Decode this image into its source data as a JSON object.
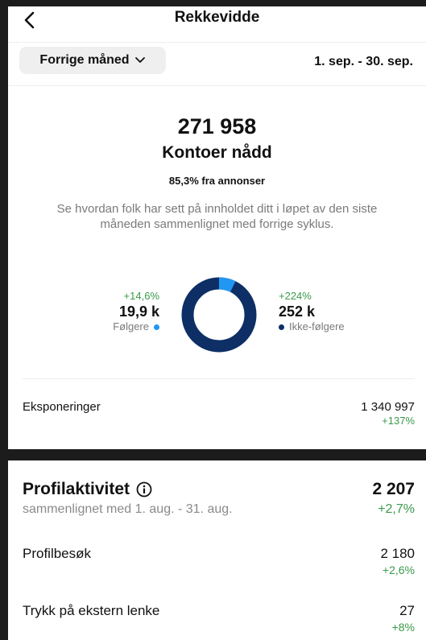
{
  "header": {
    "title": "Rekkevidde"
  },
  "period": {
    "button_label": "Forrige måned",
    "date_range": "1. sep. - 30. sep."
  },
  "reach": {
    "accounts_reached": "271 958",
    "accounts_label": "Kontoer nådd",
    "from_ads": "85,3% fra annonser",
    "description": "Se hvordan folk har sett på innholdet ditt i løpet av den siste måneden sammenlignet med forrige syklus."
  },
  "followers": {
    "change": "+14,6%",
    "value": "19,9 k",
    "label": "Følgere",
    "color": "#2196f3",
    "share": 0.073
  },
  "non_followers": {
    "change": "+224%",
    "value": "252 k",
    "label": "Ikke-følgere",
    "color": "#0d2f66",
    "share": 0.927
  },
  "impressions": {
    "label": "Eksponeringer",
    "value": "1 340 997",
    "change": "+137%"
  },
  "profile_activity": {
    "title": "Profilaktivitet",
    "comparison": "sammenlignet med 1. aug. - 31. aug.",
    "total": "2 207",
    "total_change": "+2,7%",
    "rows": [
      {
        "label": "Profilbesøk",
        "value": "2 180",
        "change": "+2,6%"
      },
      {
        "label": "Trykk på ekstern lenke",
        "value": "27",
        "change": "+8%"
      }
    ]
  }
}
